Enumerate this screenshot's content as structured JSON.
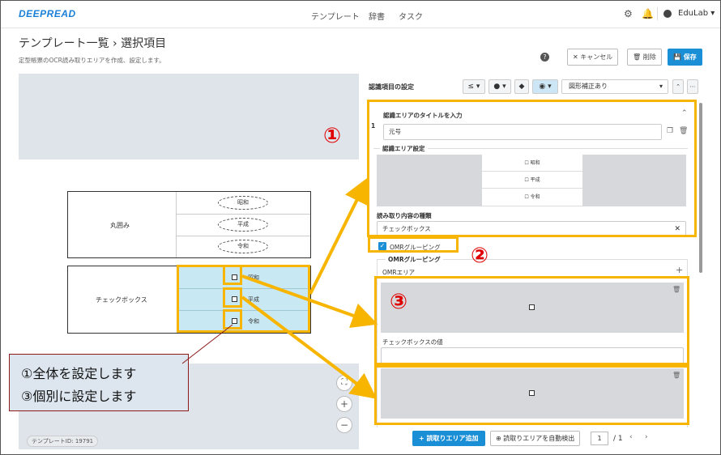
{
  "header": {
    "logo": "DEEPREAD",
    "nav": [
      "テンプレート",
      "辞書",
      "タスク"
    ],
    "user": "EduLab",
    "user_caret": "▾"
  },
  "page": {
    "title": "テンプレート一覧 › 選択項目",
    "subtitle": "定型帳票のOCR読み取りエリアを作成、設定します。",
    "help": "?",
    "cancel": "キャンセル",
    "delete": "削除",
    "save": "保存"
  },
  "canvas": {
    "group1_label": "丸囲み",
    "group2_label": "チェックボックス",
    "options": [
      "昭和",
      "平成",
      "令和"
    ],
    "template_id": "テンプレートID: 19791",
    "zoom_fit": "⛶",
    "zoom_in": "+",
    "zoom_out": "−"
  },
  "callout": {
    "line1": "①全体を設定します",
    "line2": "③個別に設定します"
  },
  "panel": {
    "title": "認識項目の設定",
    "tool_le": "≤ ▾",
    "tool_drop": "● ▾",
    "tool_erase": "◆",
    "tool_eye": "◉ ▾",
    "correction": "図形補正あり",
    "item_index": "1",
    "area_title_label": "認識エリアのタイトルを入力",
    "area_title_value": "元号",
    "area_setting_label": "認識エリア設定",
    "mini_options": [
      "☐ 昭和",
      "☐ 平成",
      "☐ 令和"
    ],
    "read_type_label": "読み取り内容の種類",
    "read_type_value": "チェックボックス",
    "omr_toggle": "OMRグルーピング",
    "omr_legend": "OMRグルーピング",
    "omr_area": "OMRエリア",
    "cb_value_label": "チェックボックスの値",
    "add_area": "読取りエリア追加",
    "auto_detect": "読取りエリアを自動検出",
    "page_current": "1",
    "page_total": "/ 1"
  },
  "annotations": {
    "n1": "①",
    "n2": "②",
    "n3": "③"
  },
  "colors": {
    "accent": "#1a8fd6",
    "highlight": "#f7b500",
    "marker": "#e00000"
  }
}
